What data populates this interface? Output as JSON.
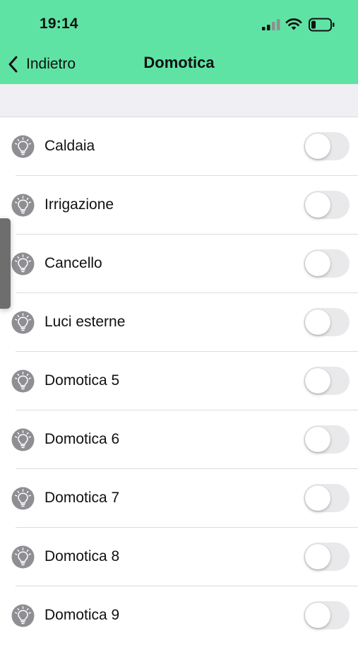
{
  "status_bar": {
    "time": "19:14"
  },
  "nav": {
    "back_label": "Indietro",
    "title": "Domotica"
  },
  "colors": {
    "header_bg": "#5fe3a4",
    "toggle_off": "#e9e9eb"
  },
  "items": [
    {
      "label": "Caldaia",
      "icon": "lightbulb-icon",
      "on": false
    },
    {
      "label": "Irrigazione",
      "icon": "lightbulb-icon",
      "on": false
    },
    {
      "label": "Cancello",
      "icon": "lightbulb-icon",
      "on": false
    },
    {
      "label": "Luci esterne",
      "icon": "lightbulb-icon",
      "on": false
    },
    {
      "label": "Domotica 5",
      "icon": "lightbulb-icon",
      "on": false
    },
    {
      "label": "Domotica 6",
      "icon": "lightbulb-icon",
      "on": false
    },
    {
      "label": "Domotica 7",
      "icon": "lightbulb-icon",
      "on": false
    },
    {
      "label": "Domotica 8",
      "icon": "lightbulb-icon",
      "on": false
    },
    {
      "label": "Domotica 9",
      "icon": "lightbulb-icon",
      "on": false
    }
  ]
}
